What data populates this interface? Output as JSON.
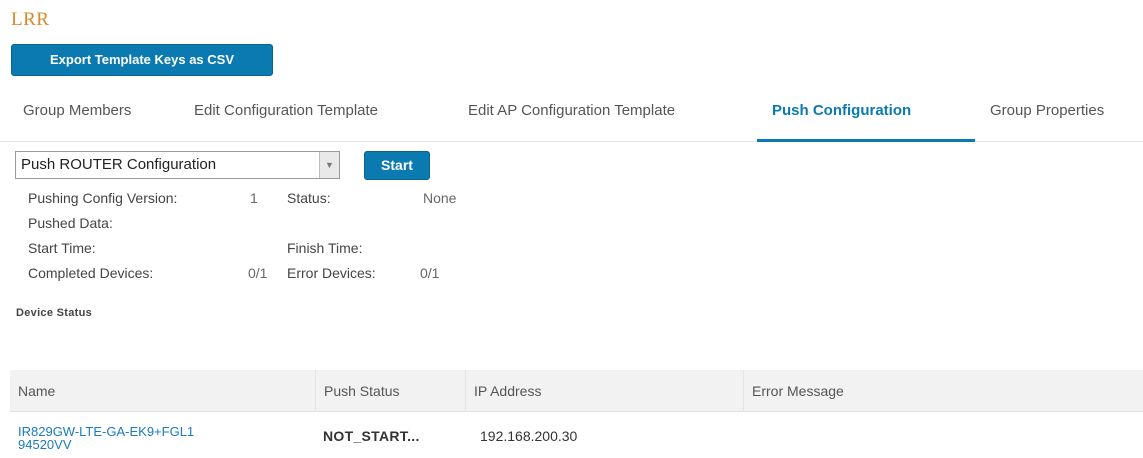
{
  "group": {
    "name": "LRR"
  },
  "toolbar": {
    "export_label": "Export Template Keys as CSV"
  },
  "tabs": [
    {
      "label": "Group Members",
      "active": false
    },
    {
      "label": "Edit Configuration Template",
      "active": false
    },
    {
      "label": "Edit AP Configuration Template",
      "active": false
    },
    {
      "label": "Push Configuration",
      "active": true
    },
    {
      "label": "Group Properties",
      "active": false
    }
  ],
  "push": {
    "select_value": "Push ROUTER Configuration",
    "start_label": "Start"
  },
  "summary": {
    "pushing_version_label": "Pushing Config Version:",
    "pushing_version_value": "1",
    "status_label": "Status:",
    "status_value": "None",
    "pushed_data_label": "Pushed Data:",
    "start_time_label": "Start Time:",
    "finish_time_label": "Finish Time:",
    "completed_label": "Completed Devices:",
    "completed_value": "0/1",
    "error_label": "Error Devices:",
    "error_value": "0/1"
  },
  "device_status": {
    "title": "Device Status",
    "columns": [
      "Name",
      "Push Status",
      "IP Address",
      "Error Message"
    ],
    "rows": [
      {
        "name": "IR829GW-LTE-GA-EK9+FGL194520VV",
        "push_status": "NOT_START...",
        "ip_address": "192.168.200.30",
        "error_message": ""
      }
    ]
  },
  "colors": {
    "accent": "#0b7ab0",
    "group_name": "#d78a2b",
    "link": "#1a7bbf"
  }
}
